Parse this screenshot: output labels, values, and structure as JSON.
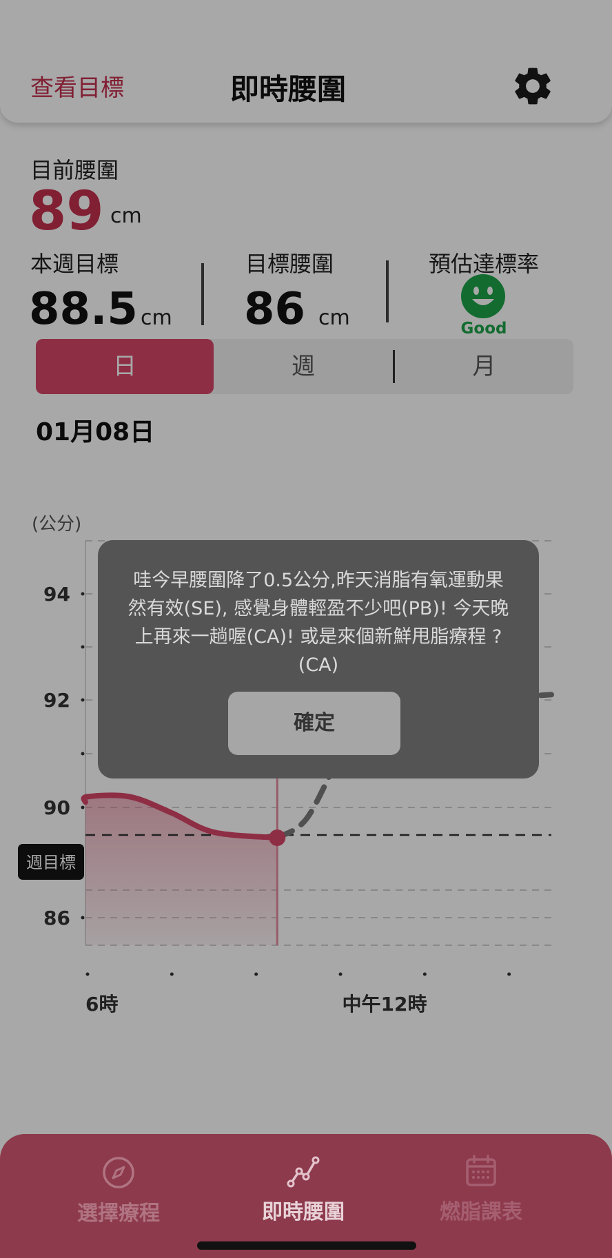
{
  "header": {
    "left_link": "查看目標",
    "title": "即時腰圍",
    "settings_icon": "gear-icon"
  },
  "current": {
    "label": "目前腰圍",
    "value": "89",
    "unit": "cm"
  },
  "stats": [
    {
      "label": "本週目標",
      "value": "88.5",
      "unit": "cm"
    },
    {
      "label": "目標腰圍",
      "value": "86",
      "unit": "cm"
    },
    {
      "label": "預估達標率",
      "icon": "smiley-icon",
      "status": "Good"
    }
  ],
  "segments": {
    "items": [
      "日",
      "週",
      "月"
    ],
    "selected": "日"
  },
  "date": "01月08日",
  "chart_data": {
    "type": "line",
    "ylabel": "(公分)",
    "y_ticks": [
      94,
      92,
      90,
      86
    ],
    "x_tick_labels": [
      "6時",
      "中午12時"
    ],
    "target_label": "週目標",
    "target_value": 89,
    "actual": {
      "x_hours": [
        5,
        6,
        7,
        8,
        9,
        10.5
      ],
      "values": [
        90.1,
        90.2,
        90.2,
        89.8,
        89.1,
        88.9
      ]
    },
    "forecast": {
      "x_hours": [
        10.5,
        11.2,
        12,
        12.5,
        13.5,
        15,
        17.2
      ],
      "values": [
        88.9,
        89.6,
        91.0,
        91.6,
        91.9,
        92.0,
        92.1
      ]
    },
    "current_point": {
      "x_hours": 10.5,
      "value": 88.9
    }
  },
  "popup": {
    "message": "哇今早腰圍降了0.5公分,昨天消脂有氧運動果然有效(SE), 感覺身體輕盈不少吧(PB)! 今天晚上再來一趟喔(CA)! 或是來個新鮮甩脂療程 ? (CA)",
    "confirm": "確定"
  },
  "bottom_nav": [
    {
      "label": "選擇療程",
      "icon": "compass-icon"
    },
    {
      "label": "即時腰圍",
      "icon": "line-chart-icon"
    },
    {
      "label": "燃脂課表",
      "icon": "calendar-icon"
    }
  ],
  "colors": {
    "accent": "#d8476a",
    "good": "#1ea34a",
    "nav_bg": "#8d3a4c"
  }
}
